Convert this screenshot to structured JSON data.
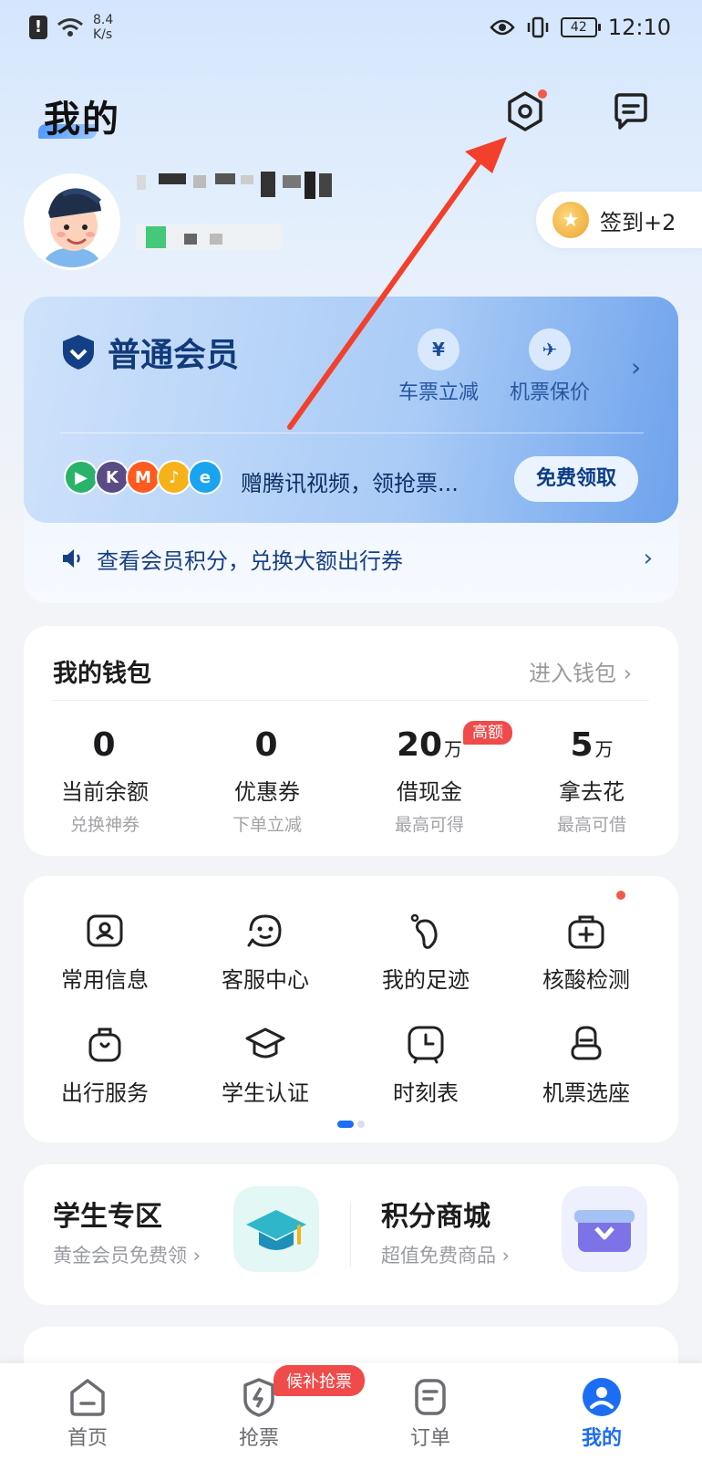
{
  "status_bar": {
    "speed": "8.4",
    "speed_unit": "K/s",
    "battery": "42",
    "time": "12:10"
  },
  "header": {
    "title": "我的"
  },
  "profile": {
    "checkin_label": "签到+2"
  },
  "member": {
    "title": "普通会员",
    "perks": [
      {
        "label": "车票立减",
        "icon": "ticket-icon"
      },
      {
        "label": "机票保价",
        "icon": "plane-icon"
      }
    ],
    "gift_text": "赠腾讯视频，领抢票...",
    "free_button": "免费领取",
    "points_text": "查看会员积分，兑换大额出行券"
  },
  "wallet": {
    "title": "我的钱包",
    "link": "进入钱包",
    "badge": "高额",
    "stats": [
      {
        "value": "0",
        "unit": "",
        "label": "当前余额",
        "sub": "兑换神券"
      },
      {
        "value": "0",
        "unit": "",
        "label": "优惠券",
        "sub": "下单立减"
      },
      {
        "value": "20",
        "unit": "万",
        "label": "借现金",
        "sub": "最高可得"
      },
      {
        "value": "5",
        "unit": "万",
        "label": "拿去花",
        "sub": "最高可借"
      }
    ]
  },
  "services": [
    {
      "label": "常用信息",
      "icon": "contact-card-icon"
    },
    {
      "label": "客服中心",
      "icon": "customer-service-icon"
    },
    {
      "label": "我的足迹",
      "icon": "footprint-icon"
    },
    {
      "label": "核酸检测",
      "icon": "medical-kit-icon"
    },
    {
      "label": "出行服务",
      "icon": "luggage-icon"
    },
    {
      "label": "学生认证",
      "icon": "graduation-cap-icon"
    },
    {
      "label": "时刻表",
      "icon": "clock-icon"
    },
    {
      "label": "机票选座",
      "icon": "seat-icon"
    }
  ],
  "zones": [
    {
      "title": "学生专区",
      "sub": "黄金会员免费领"
    },
    {
      "title": "积分商城",
      "sub": "超值免费商品"
    }
  ],
  "tabbar": {
    "wait_badge": "候补抢票",
    "tabs": [
      {
        "label": "首页",
        "icon": "home-icon"
      },
      {
        "label": "抢票",
        "icon": "lightning-icon"
      },
      {
        "label": "订单",
        "icon": "order-icon"
      },
      {
        "label": "我的",
        "icon": "profile-icon"
      }
    ]
  },
  "colors": {
    "accent": "#1b6ef3",
    "member_dark": "#113a7a",
    "alert_red": "#f04b4b",
    "annotation_arrow": "#f2402c"
  }
}
